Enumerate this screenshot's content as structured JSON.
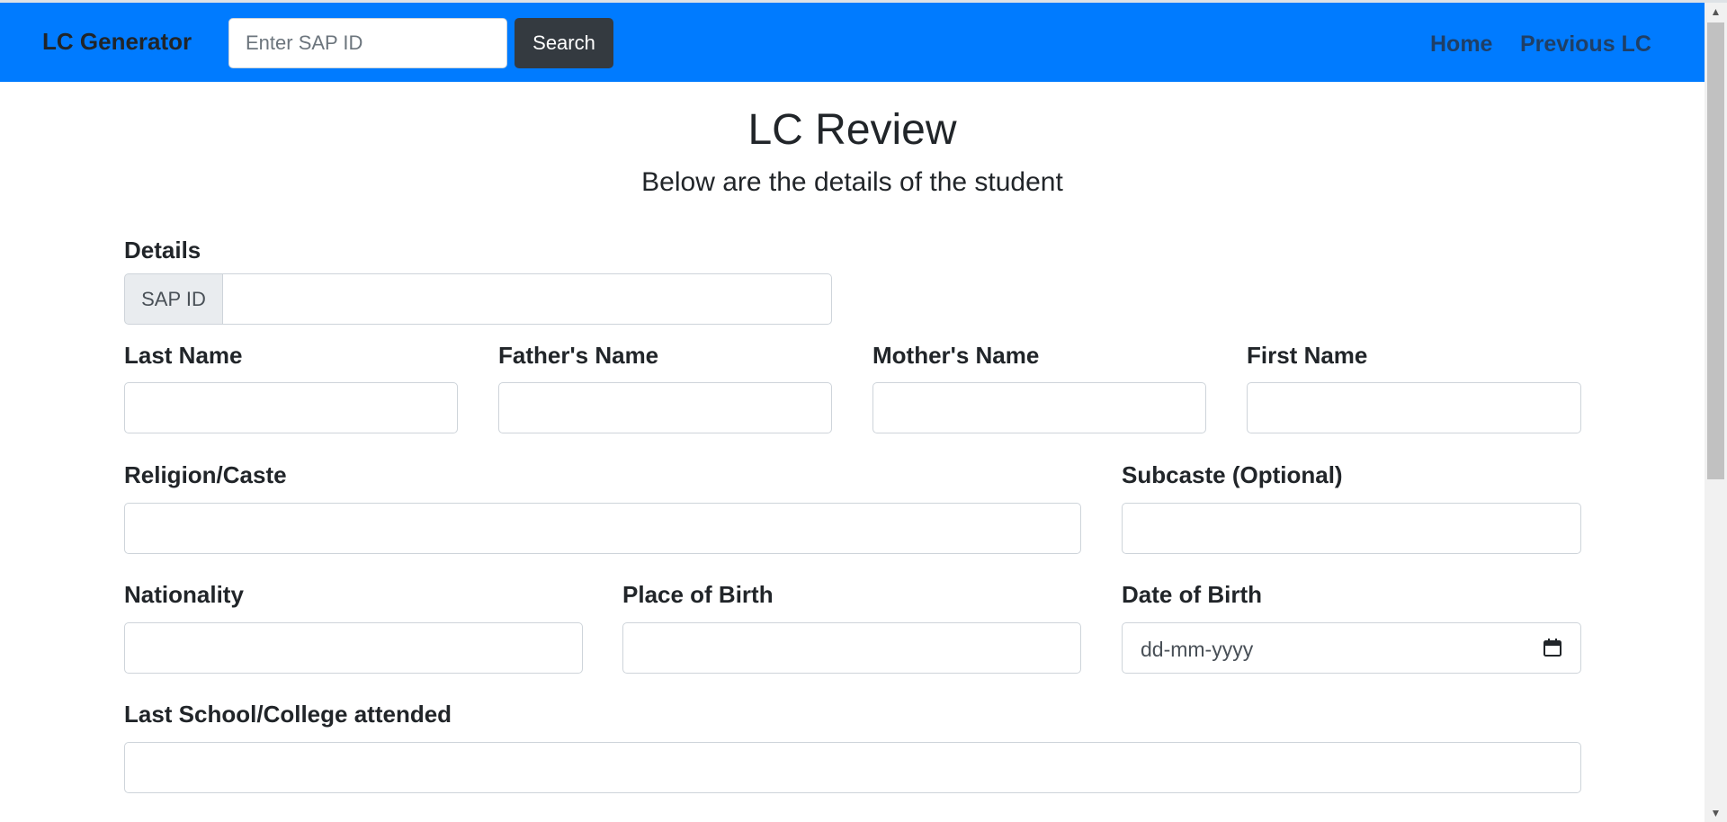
{
  "navbar": {
    "brand": "LC Generator",
    "search_placeholder": "Enter SAP ID",
    "search_button": "Search",
    "links": [
      "Home",
      "Previous LC"
    ],
    "bg_color": "#007bff"
  },
  "page": {
    "title": "LC Review",
    "subtitle": "Below are the details of the student"
  },
  "form": {
    "details_label": "Details",
    "sap_addon": "SAP ID",
    "sap_value": "",
    "last_name": "Last Name",
    "fathers_name": "Father's Name",
    "mothers_name": "Mother's Name",
    "first_name": "First Name",
    "religion_caste": "Religion/Caste",
    "subcaste": "Subcaste (Optional)",
    "nationality": "Nationality",
    "place_of_birth": "Place of Birth",
    "date_of_birth": "Date of Birth",
    "date_placeholder": "dd-mm-yyyy",
    "last_school": "Last School/College attended"
  }
}
